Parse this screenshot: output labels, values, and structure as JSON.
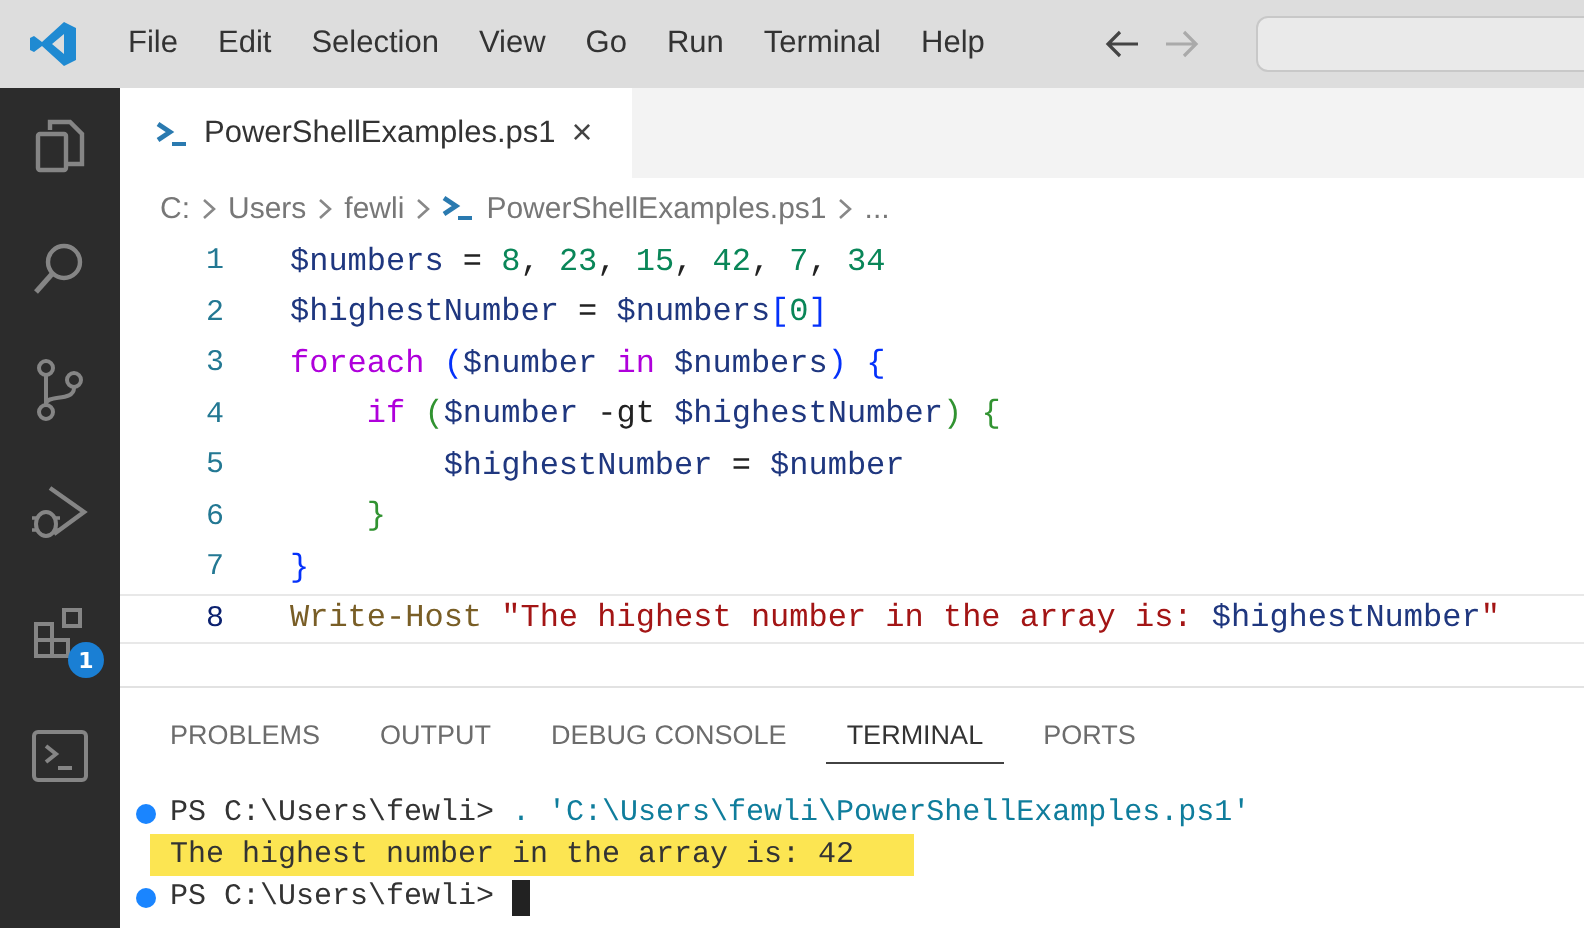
{
  "menu": [
    "File",
    "Edit",
    "Selection",
    "View",
    "Go",
    "Run",
    "Terminal",
    "Help"
  ],
  "activity_bar": [
    {
      "kind": "files",
      "selected": false
    },
    {
      "kind": "search",
      "selected": false
    },
    {
      "kind": "source",
      "selected": false
    },
    {
      "kind": "debug",
      "selected": false
    },
    {
      "kind": "extensions",
      "selected": false,
      "badge": "1"
    },
    {
      "kind": "terminal",
      "selected": false
    }
  ],
  "editor_tab": {
    "label": "PowerShellExamples.ps1",
    "close": "×",
    "selected": true
  },
  "breadcrumb": [
    "C:",
    "Users",
    "fewli",
    "PowerShellExamples.ps1",
    "..."
  ],
  "code": [
    {
      "number": "1",
      "current": false,
      "tokens": [
        {
          "kind": "var",
          "text": "$numbers"
        },
        {
          "kind": "op",
          "text": " = "
        },
        {
          "kind": "num",
          "text": "8"
        },
        {
          "kind": "op",
          "text": ", "
        },
        {
          "kind": "num",
          "text": "23"
        },
        {
          "kind": "op",
          "text": ", "
        },
        {
          "kind": "num",
          "text": "15"
        },
        {
          "kind": "op",
          "text": ", "
        },
        {
          "kind": "num",
          "text": "42"
        },
        {
          "kind": "op",
          "text": ", "
        },
        {
          "kind": "num",
          "text": "7"
        },
        {
          "kind": "op",
          "text": ", "
        },
        {
          "kind": "num",
          "text": "34"
        }
      ]
    },
    {
      "number": "2",
      "current": false,
      "tokens": [
        {
          "kind": "var",
          "text": "$highestNumber"
        },
        {
          "kind": "op",
          "text": " = "
        },
        {
          "kind": "var",
          "text": "$numbers"
        },
        {
          "kind": "bracket1",
          "text": "["
        },
        {
          "kind": "num",
          "text": "0"
        },
        {
          "kind": "bracket1",
          "text": "]"
        }
      ]
    },
    {
      "number": "3",
      "current": false,
      "tokens": [
        {
          "kind": "kw",
          "text": "foreach "
        },
        {
          "kind": "bracket1",
          "text": "("
        },
        {
          "kind": "var",
          "text": "$number"
        },
        {
          "kind": "kw",
          "text": " in "
        },
        {
          "kind": "var",
          "text": "$numbers"
        },
        {
          "kind": "bracket1",
          "text": ")"
        },
        {
          "kind": "bracket1",
          "text": " {"
        }
      ]
    },
    {
      "number": "4",
      "current": false,
      "tokens": [
        {
          "kind": "kw",
          "text": "    if "
        },
        {
          "kind": "bracket2",
          "text": "("
        },
        {
          "kind": "var",
          "text": "$number"
        },
        {
          "kind": "op",
          "text": " -gt "
        },
        {
          "kind": "var",
          "text": "$highestNumber"
        },
        {
          "kind": "bracket2",
          "text": ")"
        },
        {
          "kind": "bracket2",
          "text": " {"
        }
      ]
    },
    {
      "number": "5",
      "current": false,
      "tokens": [
        {
          "kind": "var",
          "text": "        $highestNumber"
        },
        {
          "kind": "op",
          "text": " = "
        },
        {
          "kind": "var",
          "text": "$number"
        }
      ]
    },
    {
      "number": "6",
      "current": false,
      "tokens": [
        {
          "kind": "bracket2",
          "text": "    }"
        }
      ]
    },
    {
      "number": "7",
      "current": false,
      "tokens": [
        {
          "kind": "bracket1",
          "text": "}"
        }
      ]
    },
    {
      "number": "8",
      "current": true,
      "tokens": [
        {
          "kind": "cmd",
          "text": "Write-Host "
        },
        {
          "kind": "str",
          "text": "\"The highest number in the array is: "
        },
        {
          "kind": "var",
          "text": "$highestNumber"
        },
        {
          "kind": "str",
          "text": "\""
        }
      ]
    }
  ],
  "panel_tabs": [
    {
      "label": "PROBLEMS",
      "selected": false
    },
    {
      "label": "OUTPUT",
      "selected": false
    },
    {
      "label": "DEBUG CONSOLE",
      "selected": false
    },
    {
      "label": "TERMINAL",
      "selected": true
    },
    {
      "label": "PORTS",
      "selected": false
    }
  ],
  "terminal": [
    {
      "kind": "prompt",
      "prompt": "PS C:\\Users\\fewli>",
      "command": " . 'C:\\Users\\fewli\\PowerShellExamples.ps1'",
      "highlighted": false,
      "cursor": false
    },
    {
      "kind": "output",
      "text": "The highest number in the array is: 42",
      "highlighted": true
    },
    {
      "kind": "prompt",
      "prompt": "PS C:\\Users\\fewli>",
      "highlighted": false,
      "cursor": true
    }
  ]
}
